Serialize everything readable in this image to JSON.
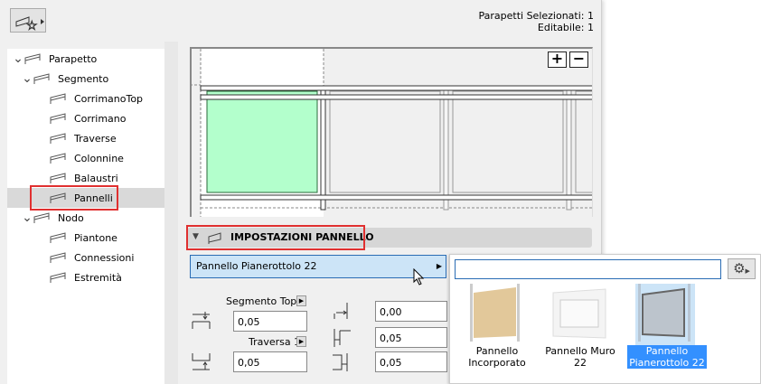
{
  "header": {
    "selected_label": "Parapetti Selezionati: 1",
    "editable_label": "Editabile: 1"
  },
  "tree": [
    {
      "label": "Parapetto",
      "level": 0,
      "expanded": true
    },
    {
      "label": "Segmento",
      "level": 1,
      "expanded": true
    },
    {
      "label": "CorrimanoTop",
      "level": 2
    },
    {
      "label": "Corrimano",
      "level": 2
    },
    {
      "label": "Traverse",
      "level": 2
    },
    {
      "label": "Colonnine",
      "level": 2
    },
    {
      "label": "Balaustri",
      "level": 2
    },
    {
      "label": "Pannelli",
      "level": 2,
      "selected": true
    },
    {
      "label": "Nodo",
      "level": 1,
      "expanded": true
    },
    {
      "label": "Piantone",
      "level": 2
    },
    {
      "label": "Connessioni",
      "level": 2
    },
    {
      "label": "Estremità",
      "level": 2
    }
  ],
  "preview": {
    "zoom_in": "+",
    "zoom_out": "−"
  },
  "section": {
    "title": "IMPOSTAZIONI PANNELLO"
  },
  "panel_select": {
    "value": "Pannello Pianerottolo 22"
  },
  "popup": {
    "search_value": "",
    "items": [
      {
        "label": "Pannello Incorporato"
      },
      {
        "label": "Pannello Muro 22"
      },
      {
        "label": "Pannello Pianerottolo 22",
        "selected": true
      }
    ]
  },
  "fields": {
    "segment_top_label": "Segmento Top",
    "top_offset": "0,05",
    "traverse_label": "Traversa 1",
    "bottom_offset": "0,05",
    "side_value_1": "0,00",
    "side_value_2": "0,05",
    "side_value_3": "0,05"
  },
  "colors": {
    "accent": "#2a6cb4",
    "selection": "#3390ff",
    "highlight": "#e03030",
    "panel_green": "#b3ffcc"
  }
}
